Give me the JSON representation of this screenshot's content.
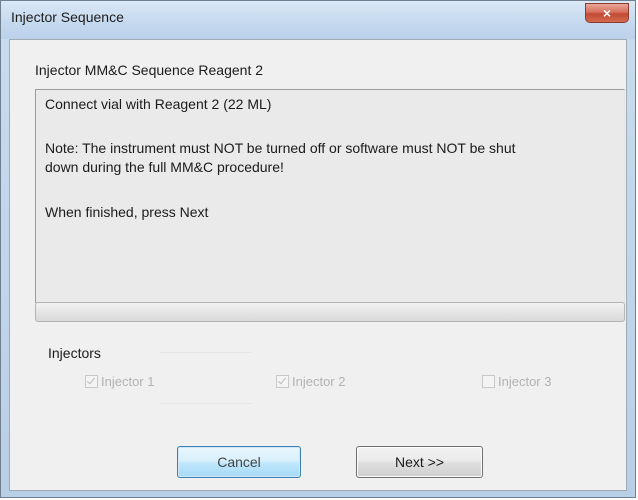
{
  "window": {
    "title": "Injector Sequence",
    "close_glyph": "×"
  },
  "dialog": {
    "heading": "Injector MM&C Sequence Reagent 2",
    "message": {
      "line1": "Connect vial with Reagent 2 (22 ML)",
      "line2": "Note: The instrument must NOT be turned off or software must NOT be shut",
      "line3": "down during the full MM&C procedure!",
      "line4": "When finished, press Next"
    },
    "progress": 0
  },
  "injectors": {
    "label": "Injectors",
    "items": [
      {
        "label": "Injector 1",
        "checked": true,
        "enabled": false
      },
      {
        "label": "Injector 2",
        "checked": true,
        "enabled": false
      },
      {
        "label": "Injector 3",
        "checked": false,
        "enabled": false
      }
    ]
  },
  "buttons": {
    "cancel": "Cancel",
    "next": "Next >>"
  }
}
